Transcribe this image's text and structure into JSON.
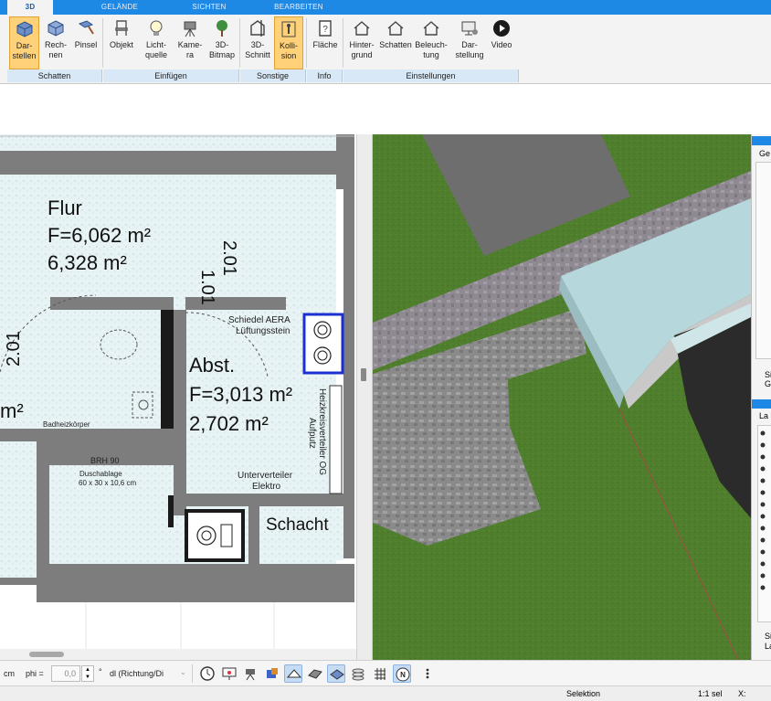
{
  "tabs": [
    {
      "label": "3D",
      "active": true
    },
    {
      "label": "GELÄNDE",
      "active": false
    },
    {
      "label": "SICHTEN",
      "active": false
    },
    {
      "label": "BEARBEITEN",
      "active": false
    }
  ],
  "ribbon": {
    "buttons": [
      {
        "label": "Dar-\nstellen",
        "icon": "cube-display-icon",
        "selected": true
      },
      {
        "label": "Rech-\nnen",
        "icon": "cube-calc-icon",
        "selected": false
      },
      {
        "label": "Pinsel",
        "icon": "brush-icon",
        "selected": false
      },
      {
        "label": "Objekt",
        "icon": "chair-icon",
        "selected": false
      },
      {
        "label": "Licht-\nquelle",
        "icon": "lightbulb-icon",
        "selected": false
      },
      {
        "label": "Kame-\nra",
        "icon": "camera-icon",
        "selected": false
      },
      {
        "label": "3D-\nBitmap",
        "icon": "tree-icon",
        "selected": false
      },
      {
        "label": "3D-\nSchnitt",
        "icon": "section-icon",
        "selected": false
      },
      {
        "label": "Kolli-\nsion",
        "icon": "collision-icon",
        "selected": true
      },
      {
        "label": "Fläche",
        "icon": "area-info-icon",
        "selected": false
      },
      {
        "label": "Hinter-\ngrund",
        "icon": "house-background-icon",
        "selected": false
      },
      {
        "label": "Schatten",
        "icon": "house-shadow-icon",
        "selected": false
      },
      {
        "label": "Beleuch-\ntung",
        "icon": "house-light-icon",
        "selected": false
      },
      {
        "label": "Dar-\nstellung",
        "icon": "monitor-icon",
        "selected": false
      },
      {
        "label": "Video",
        "icon": "play-icon",
        "selected": false
      }
    ],
    "groups": [
      "Schatten",
      "Einfügen",
      "Sonstige",
      "Info",
      "Einstellungen"
    ]
  },
  "plan": {
    "rooms": [
      {
        "name": "Flur",
        "area1": "F=6,062 m²",
        "area2": "6,328 m²"
      },
      {
        "name": "Abst.",
        "area1": "F=3,013 m²",
        "area2": "2,702 m²"
      }
    ],
    "dim_vertical_1": "1.01",
    "dim_vertical_2": "2.01",
    "dim_left": "2.01",
    "left_m2": "m²",
    "labels": {
      "aera": "Schiedel AERA",
      "aera2": "Lüftungsstein",
      "heizkreis": "Heizkreisverteiler OG",
      "aufputz": "Aufputz",
      "unterverteiler": "Unterverteiler",
      "elektro": "Elektro",
      "schacht": "Schacht",
      "badheiz": "Badheizkörper",
      "brh": "BRH 90",
      "duschablage": "Duschablage",
      "duschmass": "60 x 30 x 10,6 cm"
    }
  },
  "rightpanel": {
    "ge": "Ge",
    "si1": "Si",
    "ge2": "Ge",
    "la": "La",
    "si2": "Si",
    "la2": "La"
  },
  "toolbar": {
    "unit": "cm",
    "phi_label": "phi =",
    "phi_value": "0,0",
    "phi_unit": "°",
    "dl_value": "dl (Richtung/Di"
  },
  "status": {
    "mode": "Selektion",
    "scale": "1:1 sel",
    "x_label": "X:"
  }
}
